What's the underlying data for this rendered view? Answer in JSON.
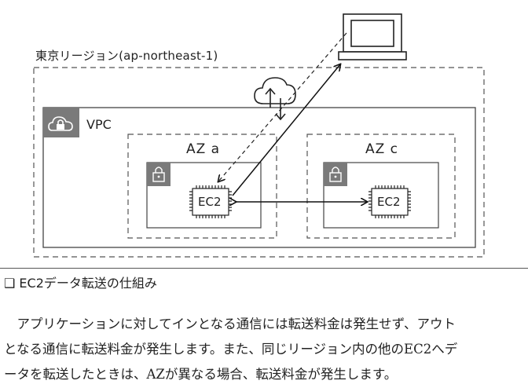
{
  "diagram": {
    "region_label": "東京リージョン(ap-northeast-1)",
    "vpc_label": "VPC",
    "az_a_label": "AZ a",
    "az_c_label": "AZ c",
    "ec2_a_label": "EC2",
    "ec2_c_label": "EC2"
  },
  "caption": "❑ EC2データ転送の仕組み",
  "paragraph": {
    "line1": "　アプリケーションに対してインとなる通信には転送料金は発生せず、アウト",
    "line2": "となる通信に転送料金が発生します。また、同じリージョン内の他のEC2へデ",
    "line3": "ータを転送したときは、AZが異なる場合、転送料金が発生します。"
  }
}
